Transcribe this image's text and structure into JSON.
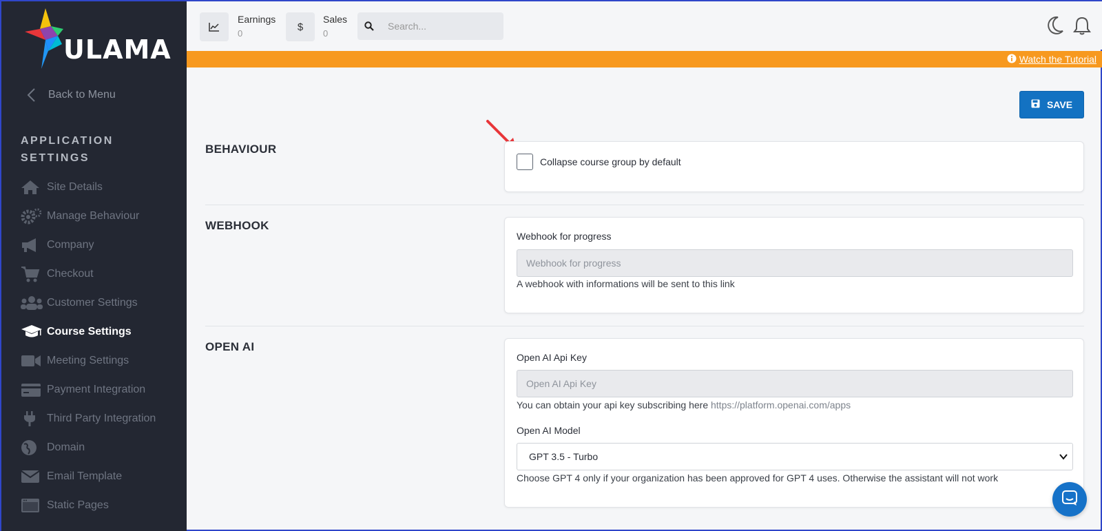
{
  "brand": {
    "name": "ULAMA"
  },
  "sidebar": {
    "back_label": "Back to Menu",
    "section_title": "APPLICATION SETTINGS",
    "items": [
      {
        "label": "Site Details",
        "icon": "home-icon"
      },
      {
        "label": "Manage Behaviour",
        "icon": "gears-icon"
      },
      {
        "label": "Company",
        "icon": "megaphone-icon"
      },
      {
        "label": "Checkout",
        "icon": "cart-icon"
      },
      {
        "label": "Customer Settings",
        "icon": "users-icon"
      },
      {
        "label": "Course Settings",
        "icon": "graduation-cap-icon",
        "active": true
      },
      {
        "label": "Meeting Settings",
        "icon": "video-icon"
      },
      {
        "label": "Payment Integration",
        "icon": "credit-card-icon"
      },
      {
        "label": "Third Party Integration",
        "icon": "plug-icon"
      },
      {
        "label": "Domain",
        "icon": "globe-icon"
      },
      {
        "label": "Email Template",
        "icon": "envelope-icon"
      },
      {
        "label": "Static Pages",
        "icon": "window-icon"
      }
    ]
  },
  "topbar": {
    "earnings": {
      "label": "Earnings",
      "value": "0"
    },
    "sales": {
      "label": "Sales",
      "value": "0",
      "icon_glyph": "$"
    },
    "search_placeholder": "Search..."
  },
  "banner": {
    "link_text": "Watch the Tutorial",
    "color": "#f7991f"
  },
  "save_label": "SAVE",
  "sections": {
    "behaviour": {
      "title": "BEHAVIOUR",
      "checkbox_label": "Collapse course group by default",
      "checked": false
    },
    "webhook": {
      "title": "WEBHOOK",
      "field_label": "Webhook for progress",
      "placeholder": "Webhook for progress",
      "help": "A webhook with informations will be sent to this link"
    },
    "openai": {
      "title": "OPEN AI",
      "key_label": "Open AI Api Key",
      "key_placeholder": "Open AI Api Key",
      "key_help": "You can obtain your api key subscribing here",
      "key_help_link": "https://platform.openai.com/apps",
      "model_label": "Open AI Model",
      "model_value": "GPT 3.5 - Turbo",
      "model_help": "Choose GPT 4 only if your organization has been approved for GPT 4 uses. Otherwise the assistant will not work"
    }
  },
  "colors": {
    "sidebar_bg": "#232732",
    "accent_blue": "#1372c2",
    "annotation_arrow": "#e8363a"
  }
}
